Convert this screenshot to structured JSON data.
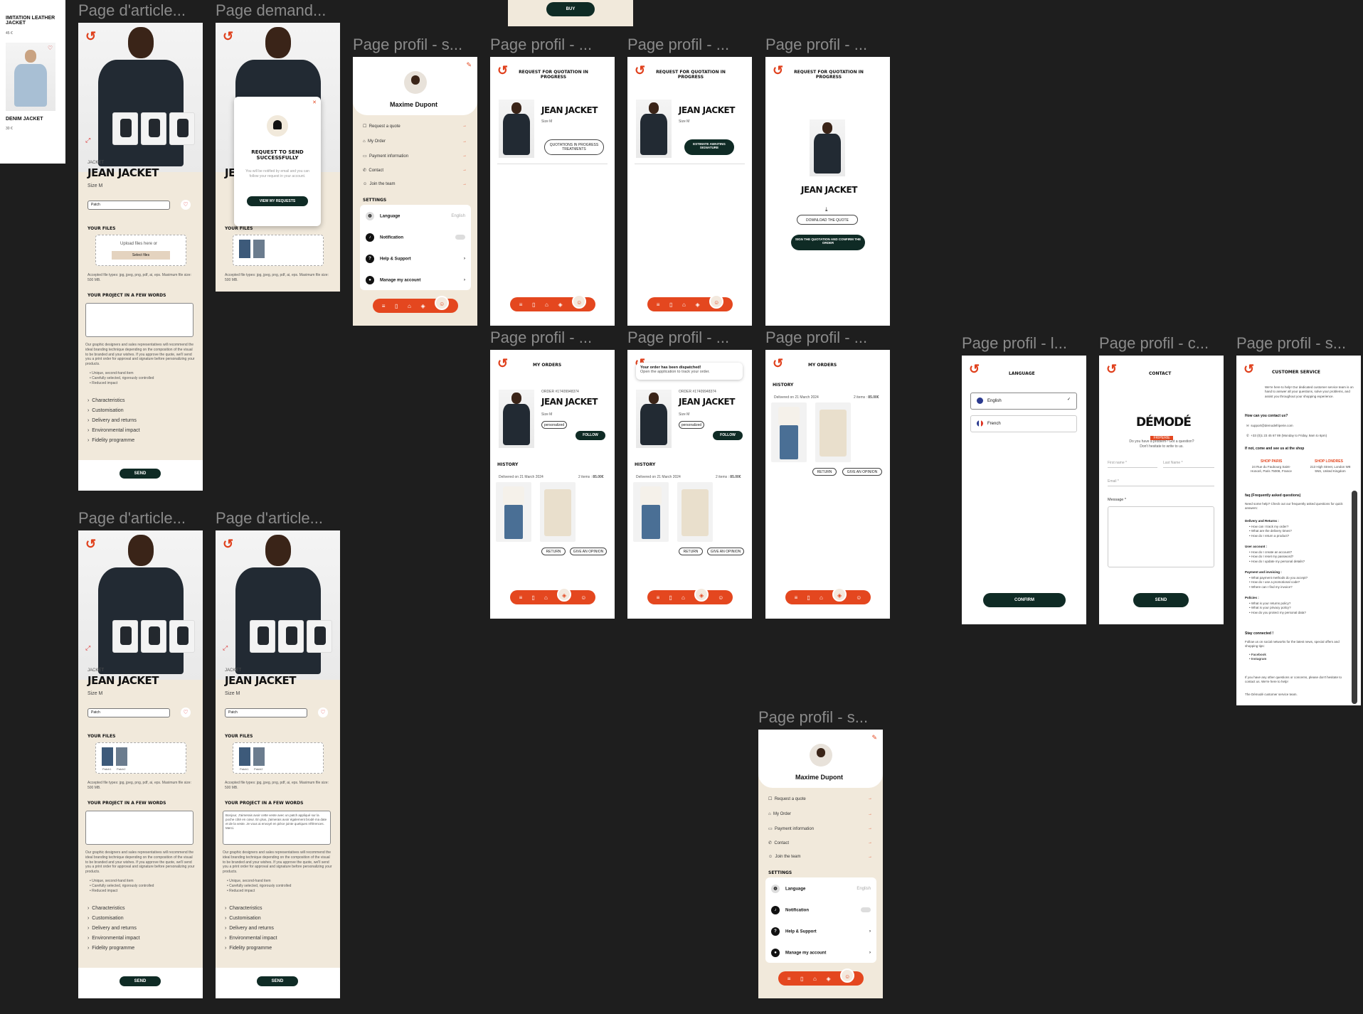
{
  "labels": {
    "article_1": "Page d'article...",
    "demande": "Page demand...",
    "profil_s": "Page profil - s...",
    "profil_a": "Page profil - ...",
    "profil_b": "Page profil - ...",
    "profil_c": "Page profil - ...",
    "profil_d": "Page profil - ...",
    "profil_e": "Page profil - ...",
    "profil_f": "Page profil - ...",
    "profil_l": "Page profil - l...",
    "profil_contact": "Page profil - c...",
    "profil_service": "Page profil - s...",
    "article_2": "Page d'article...",
    "article_3": "Page d'article...",
    "profil_s2": "Page profil - s..."
  },
  "catalog": {
    "item1_name": "IMITATION LEATHER JACKET",
    "item1_price": "45 €",
    "item2_name": "DENIM JACKET",
    "item2_price": "30 €"
  },
  "buy_button": "BUY",
  "product": {
    "category": "JACKET",
    "name": "JEAN JACKET",
    "size": "Size M",
    "select_value": "Patch",
    "your_files": "YOUR FILES",
    "upload_text": "Upload files here or",
    "select_files": "Select files",
    "accepted": "Accepted file types: jpg, jpeg, png, pdf, ai, eps. Maximum file size: 500 MB.",
    "file1": "Patch1",
    "file2": "Patch2",
    "project_title": "YOUR PROJECT IN A FEW WORDS",
    "project_text": "Bonjour, J'aimerais avoir cette veste avec un patch appliqué sur la poche côté en cœur. En plus, j'aimerais avoir également brodé ma date et de la veste. Je vous ai envoyé en pièce jointe quelques références. Merci.",
    "description": "Our graphic designers and sales representatives will recommend the ideal branding technique depending on the composition of the visual to be branded and your wishes. If you approve the quote, we'll send you a print order for approval and signature before personalizing your products.",
    "bullets": [
      "Unique, second-hand item",
      "Carefully selected, rigorously controlled",
      "Reduced impact"
    ],
    "accordions": [
      "Characteristics",
      "Customisation",
      "Delivery and returns",
      "Environmental impact",
      "Fidelity programme"
    ],
    "send": "SEND"
  },
  "modal": {
    "title": "REQUEST TO SEND SUCCESSFULLY",
    "body": "You will be notified by email and you can follow your request in your account.",
    "button": "VIEW MY REQUESTS"
  },
  "profile": {
    "name": "Maxime Dupont",
    "menu": [
      "Request a quote",
      "My Order",
      "Payment information",
      "Contact",
      "Join the team"
    ],
    "settings_title": "SETTINGS",
    "settings": [
      "Language",
      "Notification",
      "Help & Support",
      "Manage my account"
    ],
    "language_value": "English"
  },
  "quotation": {
    "title": "REQUEST FOR QUOTATION IN PROGRESS",
    "name": "JEAN JACKET",
    "size": "Size M",
    "status_in_progress": "QUOTATIONS IN PROGRESS TREATMENTS",
    "status_awaiting": "ESTIMATE AWAITING SIGNATURE",
    "download": "DOWNLOAD THE QUOTE",
    "sign": "SIGN THE QUOTATION AND CONFIRM THE ORDER"
  },
  "orders": {
    "title": "MY ORDERS",
    "order_no": "ORDER #17409948374",
    "name": "JEAN JACKET",
    "size": "Size M",
    "tag": "personalized",
    "follow": "FOLLOW",
    "history": "HISTORY",
    "delivered": "Delivered on 21 March 2024",
    "items": "2 items",
    "total": "85.00€",
    "return": "RETURN",
    "opinion": "GIVE AN OPINION",
    "toast_title": "Your order has been dispatched!",
    "toast_body": "Open the application to track your order."
  },
  "language_page": {
    "title": "LANGUAGE",
    "options": [
      "English",
      "French"
    ],
    "confirm": "CONFIRM"
  },
  "contact_page": {
    "title": "CONTACT",
    "brand": "DÉMODÉ",
    "brand_sub": "FRIPERIE",
    "intro": "Do you have a problem? Got a question? Don't hesitate to write to us.",
    "first_name": "First name *",
    "last_name": "Last Name *",
    "email": "Email *",
    "message": "Message *",
    "send": "SEND"
  },
  "service_page": {
    "title": "CUSTOMER SERVICE",
    "intro": "We're here to help! Our dedicated customer service team is on hand to answer all your questions, solve your problems, and assist you throughout your shopping experience.",
    "contact_h": "How can you contact us?",
    "email": "support@demodefriperie.com",
    "phone": "+33 (0)1 23 45 67 89 (Monday to Friday, 9am to 6pm)",
    "shops_h": "If not, come and see us at the shop",
    "shop_paris": "SHOP PARIS",
    "shop_paris_addr": "24 Rue du Faubourg Saint-Honoré, Paris 75008, France",
    "shop_london": "SHOP LONDRES",
    "shop_london_addr": "213 High Street, London W8 5NS, United Kingdom",
    "faq_h": "faq (Frequently asked questions)",
    "faq_intro": "Need some help? Check out our frequently asked questions for quick answers:",
    "faq_groups": [
      {
        "title": "Delivery and Returns :",
        "items": [
          "How can I track my order?",
          "What are the delivery times?",
          "How do I return a product?"
        ]
      },
      {
        "title": "User account :",
        "items": [
          "How do I create an account?",
          "How do I reset my password?",
          "How do I update my personal details?"
        ]
      },
      {
        "title": "Payment and invoicing :",
        "items": [
          "What payment methods do you accept?",
          "How do I use a promotional code?",
          "Where can I find my invoice?"
        ]
      },
      {
        "title": "Policies :",
        "items": [
          "What is your returns policy?",
          "What is your privacy policy?",
          "How do you protect my personal data?"
        ]
      }
    ],
    "stay_h": "Stay connected !",
    "stay_text": "Follow us on social networks for the latest news, special offers and shopping tips:",
    "socials": [
      "Facebook",
      "Instagram"
    ],
    "outro": "If you have any other questions or concerns, please don't hesitate to contact us. We're here to help!",
    "sign": "The Démodé customer service team."
  }
}
